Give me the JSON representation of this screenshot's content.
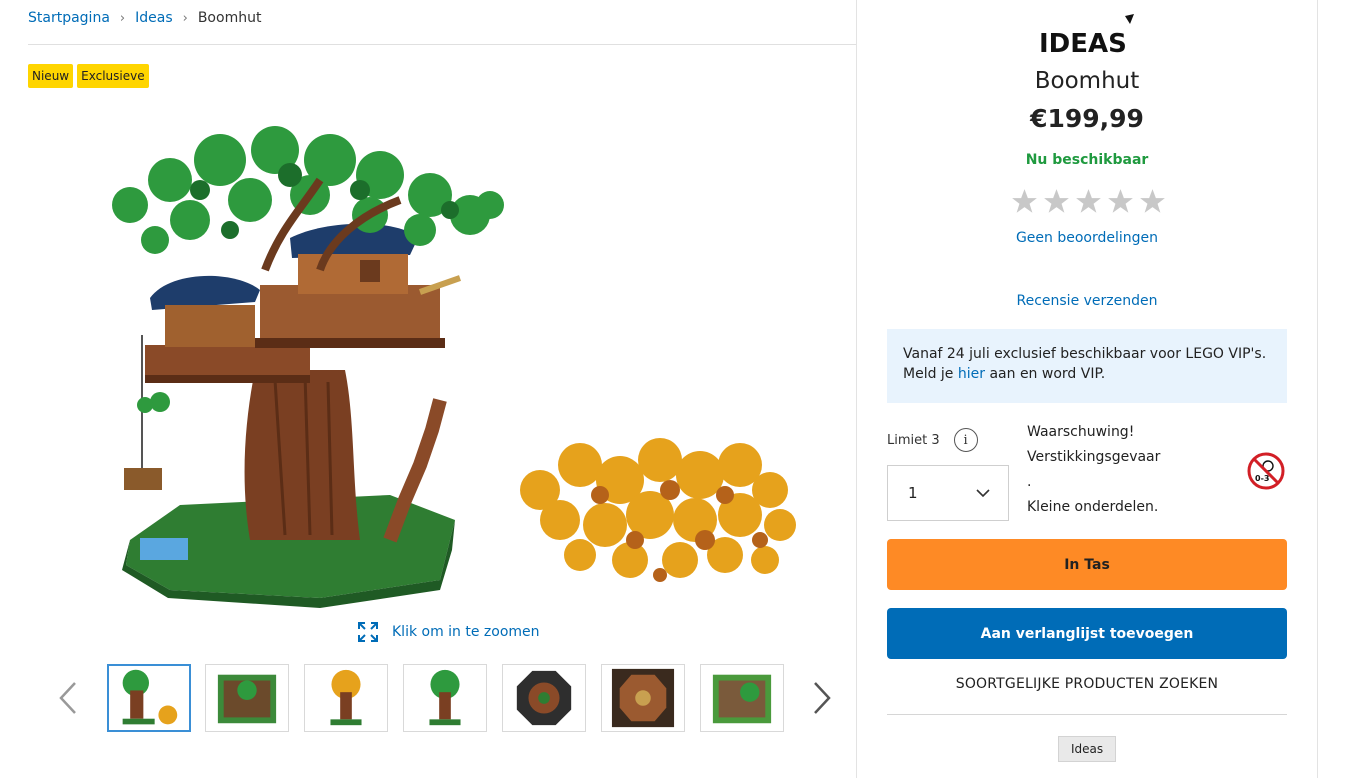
{
  "breadcrumb": {
    "items": [
      "Startpagina",
      "Ideas"
    ],
    "current": "Boomhut"
  },
  "badges": [
    "Nieuw",
    "Exclusieve"
  ],
  "gallery": {
    "zoom_label": "Klik om in te zoomen",
    "thumbnail_count": 7,
    "active_thumbnail": 1
  },
  "product": {
    "brand_logo_text": "IDEAS",
    "title": "Boomhut",
    "price": "€199,99",
    "availability": "Nu beschikbaar",
    "rating_stars": 5,
    "reviews_label": "Geen beoordelingen",
    "write_review_label": "Recensie verzenden"
  },
  "vip": {
    "line1": "Vanaf 24 juli exclusief beschikbaar voor LEGO VIP's.",
    "prefix": "Meld je ",
    "link": "hier",
    "suffix": " aan en word VIP."
  },
  "purchase": {
    "limit_label": "Limiet 3",
    "info_icon": "i",
    "quantity": "1",
    "warning_lines": [
      "Waarschuwing!",
      "Verstikkingsgevaar",
      ".",
      "Kleine onderdelen."
    ],
    "warning_icon_text": "0-3",
    "bag_button": "In Tas",
    "wishlist_button": "Aan verlanglijst toevoegen",
    "similar_label": "SOORTGELIJKE PRODUCTEN ZOEKEN",
    "tag": "Ideas"
  },
  "colors": {
    "link": "#006cb7",
    "badge": "#ffd500",
    "bag_button": "#fe8a25",
    "wishlist_button": "#006cb7",
    "available": "#1f9a3f",
    "vip_bg": "#e8f3fd"
  }
}
